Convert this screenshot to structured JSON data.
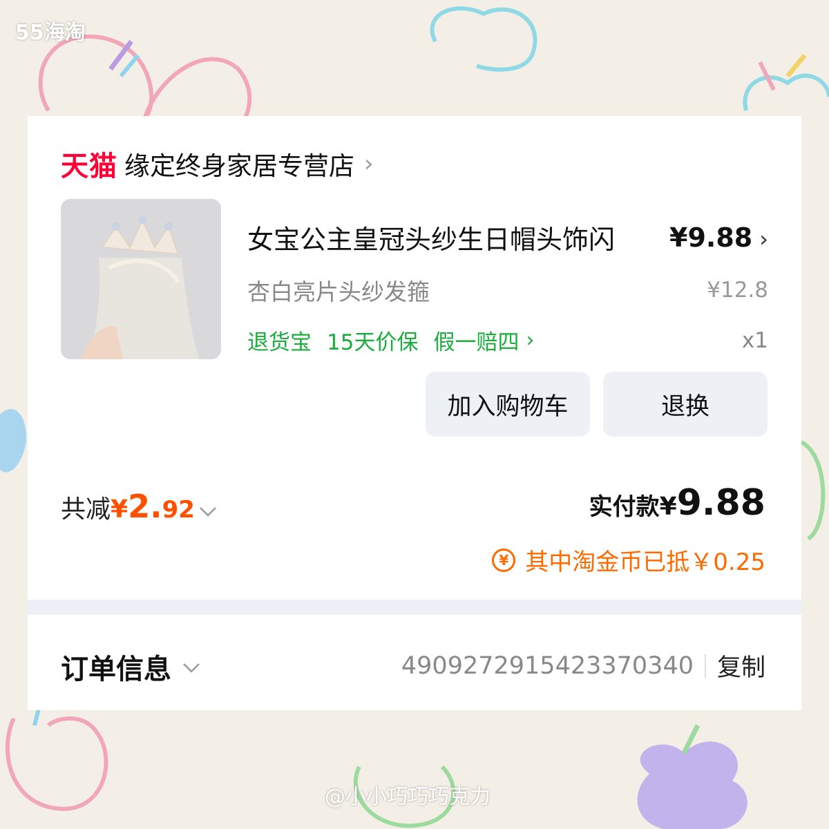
{
  "watermark": {
    "top_left": "55海淘",
    "bottom": "@小小巧巧巧克力"
  },
  "store": {
    "platform": "天猫",
    "name": "缘定终身家居专营店",
    "chevron": "›"
  },
  "product": {
    "title": "女宝公主皇冠头纱生日帽头饰闪",
    "price": "¥9.88",
    "price_chevron": "›",
    "sku": "杏白亮片头纱发箍",
    "original_price": "¥12.8",
    "services": [
      "退货宝",
      "15天价保",
      "假一赔四"
    ],
    "service_chevron": "›",
    "quantity": "x1"
  },
  "actions": {
    "add_to_cart": "加入购物车",
    "return_exchange": "退换"
  },
  "summary": {
    "discount_label": "共减",
    "discount_currency": "¥",
    "discount_int": "2.",
    "discount_dec": "92",
    "paid_label": "实付款",
    "paid_currency": "¥",
    "paid_amount": "9.88",
    "coin_icon": "¥",
    "coin_text": "其中淘金币已抵￥0.25"
  },
  "order": {
    "label": "订单信息",
    "number": "4909272915423370340",
    "copy_label": "复制"
  },
  "colors": {
    "tmall_red": "#ff0036",
    "accent_orange": "#ff5000",
    "service_green": "#1aad3e",
    "button_bg": "#edf1f6"
  },
  "icons": [
    "chevron-right-icon",
    "chevron-down-icon",
    "coin-icon"
  ]
}
